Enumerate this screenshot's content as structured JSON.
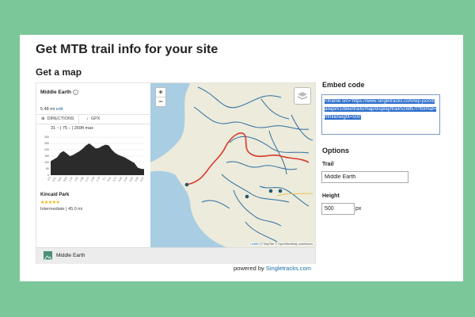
{
  "page": {
    "title": "Get MTB trail info for your site",
    "subtitle": "Get a map"
  },
  "widget": {
    "trail_name": "Middle Earth",
    "distance": "5.48 mi",
    "edit_link": "edit",
    "directions_label": "DIRECTIONS",
    "gpx_label": "GPX",
    "elevation_stats": "31 ↑ | 75 ↓ | 269ft max",
    "park_name": "Kincaid Park",
    "stars": "★★★★★",
    "rating_value": 5,
    "meta": "Intermediate | 45.0 mi",
    "footer_name": "Middle Earth",
    "zoom_in": "+",
    "zoom_out": "−",
    "attribution_leaflet": "Leaflet",
    "attribution_rest": " | © MapTiler © OpenStreetMap contributors",
    "elevation_profile": {
      "x_labels": [
        "0.0",
        "0.31",
        "0.62",
        "0.93",
        "1.24",
        "1.55",
        "1.86",
        "2.17",
        "2.48",
        "2.79",
        "3.1",
        "3.41",
        "3.72",
        "4.03",
        "4.34",
        "4.65",
        "4.96",
        "5.27"
      ],
      "y_labels": [
        "300",
        "250",
        "200",
        "150",
        "100",
        "50",
        "0"
      ],
      "y_max": 300,
      "values": [
        110,
        125,
        140,
        175,
        190,
        170,
        150,
        160,
        175,
        190,
        210,
        235,
        250,
        230,
        210,
        215,
        230,
        240,
        235,
        200,
        175,
        160,
        150,
        140,
        125,
        110,
        95,
        60,
        50,
        48
      ]
    }
  },
  "powered_by": {
    "prefix": "powered by ",
    "link": "Singletracks.com"
  },
  "embed": {
    "label": "Embed code",
    "code": "<iframe src='https://www.singletracks.com/wp-json/trailapi/v1/bike/trails/map/display/trail/516857/?format=html&height=500'"
  },
  "options": {
    "label": "Options",
    "trail_label": "Trail",
    "trail_value": "Middle Earth",
    "height_label": "Height",
    "height_value": "500",
    "height_unit": "px"
  },
  "colors": {
    "background": "#7cc79a",
    "water": "#a9cde3",
    "land": "#ecebdc",
    "trail_line": "#d93a2a",
    "other_trails": "#2f6e9e",
    "link": "#1d6ea8",
    "selection": "#2d6fcb"
  },
  "icons": {
    "info": "info-circle-icon",
    "directions": "compass-icon",
    "gpx": "download-icon",
    "layers": "layers-icon",
    "logo": "mountain-logo-icon"
  }
}
